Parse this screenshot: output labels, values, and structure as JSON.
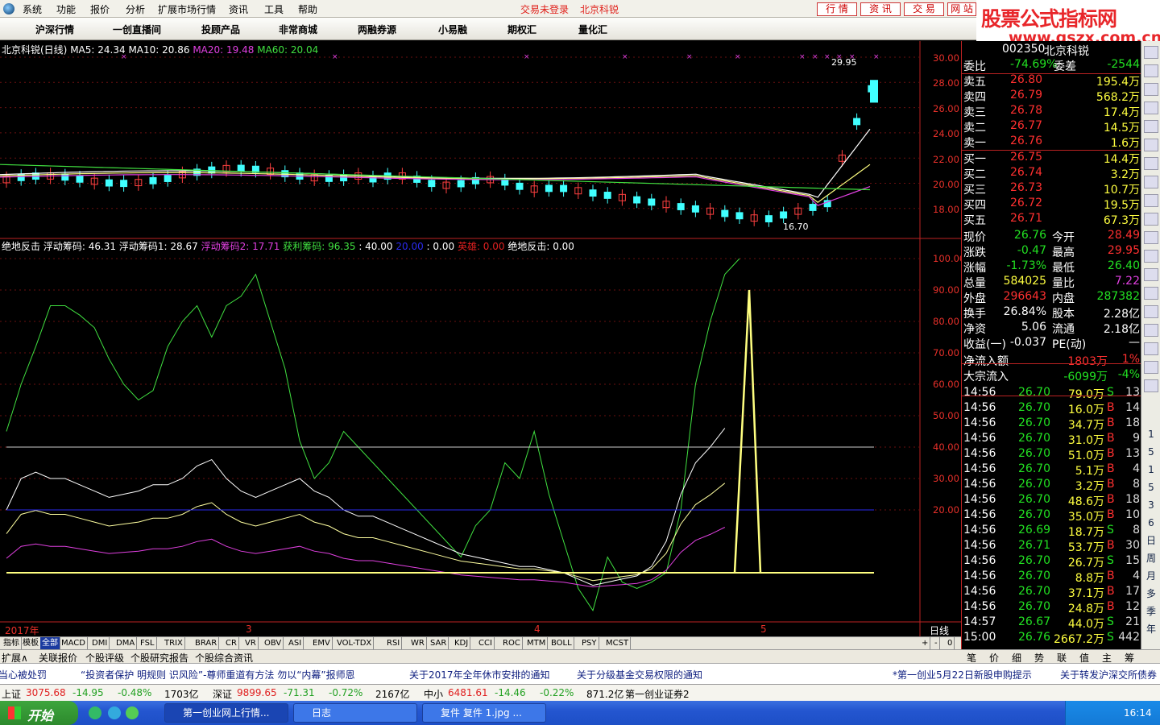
{
  "menu": {
    "items": [
      "系统",
      "功能",
      "报价",
      "分析",
      "扩展市场行情",
      "资讯",
      "工具",
      "帮助"
    ],
    "status_login": "交易未登录",
    "status_stock": "北京科锐",
    "right_buttons": [
      "行 情",
      "资 讯",
      "交 易",
      "网 站"
    ]
  },
  "logo": {
    "line1": "股票公式指标网",
    "line2": "www.gszx.com.cn"
  },
  "toolbar": {
    "tabs": [
      "沪深行情",
      "一创直播间",
      "投顾产品",
      "非常商城",
      "两融券源",
      "小易融",
      "期权汇",
      "量化汇"
    ]
  },
  "main_chart": {
    "legend": [
      {
        "text": "北京科锐(日线)",
        "color": "#ffffff"
      },
      {
        "text": "MA5: 24.34",
        "color": "#ffffff"
      },
      {
        "text": "MA10: 20.86",
        "color": "#ffffff"
      },
      {
        "text": "MA20: 19.48",
        "color": "#e040e0"
      },
      {
        "text": "MA60: 20.04",
        "color": "#40e040"
      }
    ],
    "y_ticks": [
      "30.00",
      "28.00",
      "26.00",
      "24.00",
      "22.00",
      "20.00",
      "18.00"
    ],
    "high_label": "29.95",
    "low_label": "16.70"
  },
  "indicator": {
    "legend": [
      {
        "text": "绝地反击",
        "color": "#ffffff"
      },
      {
        "text": "浮动筹码: 46.31",
        "color": "#ffffff"
      },
      {
        "text": "浮动筹码1: 28.67",
        "color": "#ffffff"
      },
      {
        "text": "浮动筹码2: 17.71",
        "color": "#e040e0"
      },
      {
        "text": "获利筹码: 96.35",
        "color": "#40e040"
      },
      {
        "text": ": 40.00",
        "color": "#ffffff"
      },
      {
        "text": "20.00",
        "color": "#2a2aee"
      },
      {
        "text": ": 0.00",
        "color": "#ffffff"
      },
      {
        "text": "英雄: 0.00",
        "color": "#e02020"
      },
      {
        "text": "绝地反击: 0.00",
        "color": "#ffffff"
      }
    ],
    "y_ticks": [
      "100.00",
      "90.00",
      "80.00",
      "70.00",
      "60.00",
      "50.00",
      "40.00",
      "30.00",
      "20.00"
    ]
  },
  "time_axis": {
    "labels": [
      "2017年",
      "3",
      "4",
      "5"
    ],
    "period": "日线"
  },
  "indicator_tabs": [
    "指标",
    "模板",
    "全部",
    "MACD",
    "DMI",
    "DMA",
    "FSL",
    "TRIX",
    "BRAR",
    "CR",
    "VR",
    "OBV",
    "ASI",
    "EMV",
    "VOL-TDX",
    "RSI",
    "WR",
    "SAR",
    "KDJ",
    "CCI",
    "ROC",
    "MTM",
    "BOLL",
    "PSY",
    "MCST"
  ],
  "tab_controls": [
    "+",
    "-",
    "0"
  ],
  "bottom_tabs": [
    "扩展∧",
    "关联报价",
    "个股评级",
    "个股研究报告",
    "个股综合资讯"
  ],
  "side_tabs": [
    "笔",
    "价",
    "细",
    "势",
    "联",
    "值",
    "主",
    "筹"
  ],
  "quote": {
    "title_code": "002350",
    "title_name": "北京科锐",
    "weibi": {
      "label1": "委比",
      "v1": "-74.69%",
      "label2": "委差",
      "v2": "-2544"
    },
    "sells": [
      {
        "label": "卖五",
        "price": "26.80",
        "vol": "195.4万"
      },
      {
        "label": "卖四",
        "price": "26.79",
        "vol": "568.2万"
      },
      {
        "label": "卖三",
        "price": "26.78",
        "vol": "17.4万"
      },
      {
        "label": "卖二",
        "price": "26.77",
        "vol": "14.5万"
      },
      {
        "label": "卖一",
        "price": "26.76",
        "vol": "1.6万"
      }
    ],
    "buys": [
      {
        "label": "买一",
        "price": "26.75",
        "vol": "14.4万"
      },
      {
        "label": "买二",
        "price": "26.74",
        "vol": "3.2万"
      },
      {
        "label": "买三",
        "price": "26.73",
        "vol": "10.7万"
      },
      {
        "label": "买四",
        "price": "26.72",
        "vol": "19.5万"
      },
      {
        "label": "买五",
        "price": "26.71",
        "vol": "67.3万"
      }
    ],
    "stats": [
      {
        "l1": "现价",
        "v1": "26.76",
        "c1": "#22e022",
        "l2": "今开",
        "v2": "28.49",
        "c2": "#ff3030"
      },
      {
        "l1": "涨跌",
        "v1": "-0.47",
        "c1": "#22e022",
        "l2": "最高",
        "v2": "29.95",
        "c2": "#ff3030"
      },
      {
        "l1": "涨幅",
        "v1": "-1.73%",
        "c1": "#22e022",
        "l2": "最低",
        "v2": "26.40",
        "c2": "#22e022"
      },
      {
        "l1": "总量",
        "v1": "584025",
        "c1": "#ffff40",
        "l2": "量比",
        "v2": "7.22",
        "c2": "#e040e0"
      },
      {
        "l1": "外盘",
        "v1": "296643",
        "c1": "#ff3030",
        "l2": "内盘",
        "v2": "287382",
        "c2": "#22e022"
      },
      {
        "l1": "换手",
        "v1": "26.84%",
        "c1": "#ffffff",
        "l2": "股本",
        "v2": "2.28亿",
        "c2": "#ffffff"
      },
      {
        "l1": "净资",
        "v1": "5.06",
        "c1": "#ffffff",
        "l2": "流通",
        "v2": "2.18亿",
        "c2": "#ffffff"
      },
      {
        "l1": "收益(一)",
        "v1": "-0.037",
        "c1": "#ffffff",
        "l2": "PE(动)",
        "v2": "—",
        "c2": "#ffffff"
      }
    ],
    "flows": [
      {
        "label": "净流入额",
        "value": "1803万",
        "pct": "1%",
        "color": "#ff3030"
      },
      {
        "label": "大宗流入",
        "value": "-6099万",
        "pct": "-4%",
        "color": "#22e022"
      }
    ],
    "ticks": [
      {
        "t": "14:56",
        "p": "26.70",
        "v": "79.0万",
        "bs": "S",
        "n": "13"
      },
      {
        "t": "14:56",
        "p": "26.70",
        "v": "16.0万",
        "bs": "B",
        "n": "14"
      },
      {
        "t": "14:56",
        "p": "26.70",
        "v": "34.7万",
        "bs": "B",
        "n": "18"
      },
      {
        "t": "14:56",
        "p": "26.70",
        "v": "31.0万",
        "bs": "B",
        "n": "9"
      },
      {
        "t": "14:56",
        "p": "26.70",
        "v": "51.0万",
        "bs": "B",
        "n": "13"
      },
      {
        "t": "14:56",
        "p": "26.70",
        "v": "5.1万",
        "bs": "B",
        "n": "4"
      },
      {
        "t": "14:56",
        "p": "26.70",
        "v": "3.2万",
        "bs": "B",
        "n": "8"
      },
      {
        "t": "14:56",
        "p": "26.70",
        "v": "48.6万",
        "bs": "B",
        "n": "18"
      },
      {
        "t": "14:56",
        "p": "26.70",
        "v": "35.0万",
        "bs": "B",
        "n": "10"
      },
      {
        "t": "14:56",
        "p": "26.69",
        "v": "18.7万",
        "bs": "S",
        "n": "8"
      },
      {
        "t": "14:56",
        "p": "26.71",
        "v": "53.7万",
        "bs": "B",
        "n": "30"
      },
      {
        "t": "14:56",
        "p": "26.70",
        "v": "26.7万",
        "bs": "S",
        "n": "15"
      },
      {
        "t": "14:56",
        "p": "26.70",
        "v": "8.8万",
        "bs": "B",
        "n": "4"
      },
      {
        "t": "14:56",
        "p": "26.70",
        "v": "37.1万",
        "bs": "B",
        "n": "17"
      },
      {
        "t": "14:56",
        "p": "26.70",
        "v": "24.8万",
        "bs": "B",
        "n": "12"
      },
      {
        "t": "14:57",
        "p": "26.67",
        "v": "44.0万",
        "bs": "S",
        "n": "21"
      },
      {
        "t": "15:00",
        "p": "26.76",
        "v": "2667.2万",
        "bs": "S",
        "n": "442"
      }
    ]
  },
  "toolbar_right": [
    "1",
    "5",
    "1",
    "5",
    "3",
    "6",
    "日",
    "周",
    "月",
    "多",
    "季",
    "年"
  ],
  "news": [
    "当心被处罚",
    "“投资者保护 明规则 识风险”-尊师重道有方法 勿以“内幕”报师恩",
    "关于2017年全年休市安排的通知",
    "关于分级基金交易权限的通知",
    "*第一创业5月22日新股申购提示",
    "关于转发沪深交所债券"
  ],
  "index_bar": [
    {
      "name": "上证",
      "val": "3075.68",
      "chg": "-14.95",
      "pct": "-0.48%",
      "amt": "1703亿"
    },
    {
      "name": "深证",
      "val": "9899.65",
      "chg": "-71.31",
      "pct": "-0.72%",
      "amt": "2167亿"
    },
    {
      "name": "中小",
      "val": "6481.61",
      "chg": "-14.46",
      "pct": "-0.22%",
      "amt": "871.2亿"
    }
  ],
  "broker": "第一创业证券2",
  "taskbar": {
    "start": "开始",
    "windows": [
      "第一创业网上行情...",
      "日志",
      "复件 复件 1.jpg ..."
    ],
    "clock": "16:14"
  }
}
